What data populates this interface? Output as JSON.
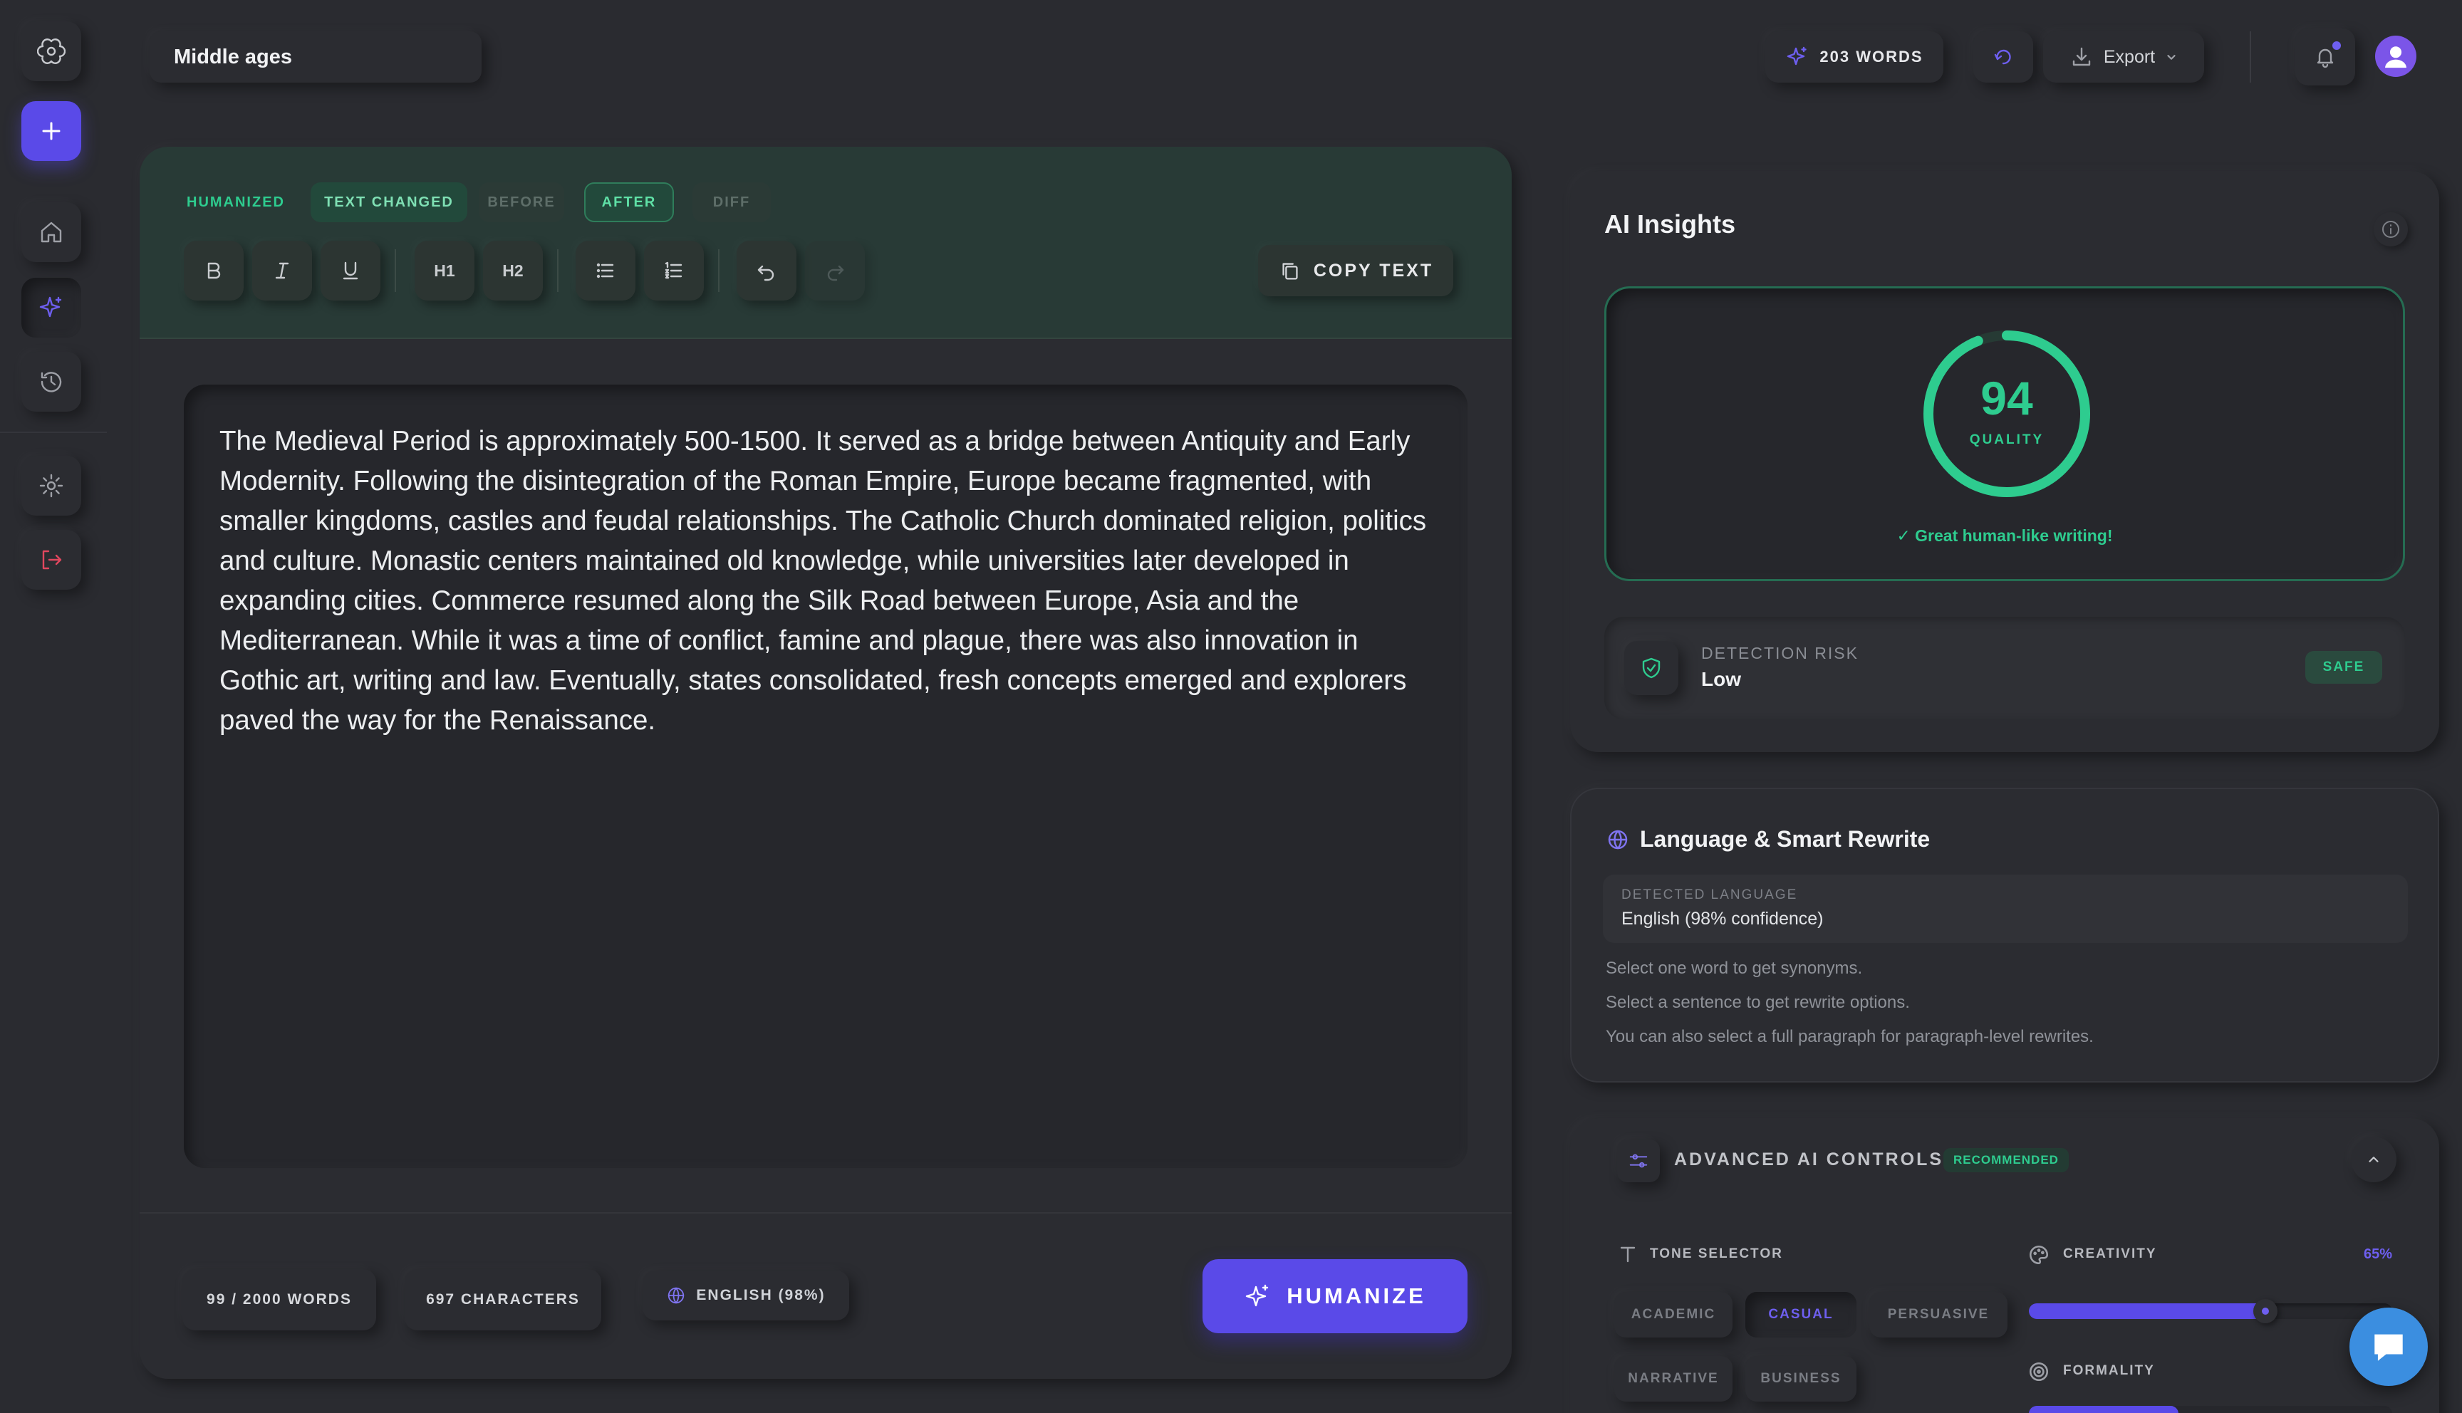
{
  "header": {
    "doc_title": "Middle ages",
    "word_count_badge": "203 WORDS",
    "export_label": "Export"
  },
  "editor": {
    "chips": {
      "humanized": "HUMANIZED",
      "text_changed": "TEXT CHANGED",
      "before": "BEFORE",
      "after": "AFTER",
      "diff": "DIFF"
    },
    "format": {
      "h1": "H1",
      "h2": "H2"
    },
    "copy_label": "COPY TEXT",
    "body_text": "The Medieval Period is approximately 500-1500. It served as a bridge between Antiquity and Early Modernity. Following the disintegration of the Roman Empire, Europe became fragmented, with smaller kingdoms, castles and feudal relationships. The Catholic Church dominated religion, politics and culture. Monastic centers maintained old knowledge, while universities later developed in expanding cities. Commerce resumed along the Silk Road between Europe, Asia and the Mediterranean. While it was a time of conflict, famine and plague, there was also innovation in Gothic art, writing and law. Eventually, states consolidated, fresh concepts emerged and explorers paved the way for the Renaissance.",
    "footer": {
      "words": "99 / 2000 WORDS",
      "characters": "697 CHARACTERS",
      "language": "ENGLISH (98%)",
      "humanize_label": "HUMANIZE"
    }
  },
  "insights": {
    "title": "AI Insights",
    "quality_score": "94",
    "quality_value": 94,
    "quality_label": "QUALITY",
    "quality_message": "✓ Great human-like writing!",
    "detection_label": "DETECTION RISK",
    "detection_value": "Low",
    "detection_badge": "SAFE"
  },
  "language": {
    "title": "Language & Smart Rewrite",
    "detected_label": "DETECTED LANGUAGE",
    "detected_value": "English (98% confidence)",
    "hints": [
      "Select one word to get synonyms.",
      "Select a sentence to get rewrite options.",
      "You can also select a full paragraph for paragraph-level rewrites."
    ]
  },
  "advanced": {
    "title": "ADVANCED AI CONTROLS",
    "badge": "RECOMMENDED",
    "tone_label": "TONE SELECTOR",
    "tones": [
      "ACADEMIC",
      "CASUAL",
      "PERSUASIVE",
      "NARRATIVE",
      "BUSINESS"
    ],
    "selected_tone": "CASUAL",
    "creativity_label": "CREATIVITY",
    "creativity_value": "65%",
    "creativity_fraction": 0.65,
    "formality_label": "FORMALITY"
  },
  "colors": {
    "accent": "#5a4ae8",
    "success": "#2ecc8f",
    "background": "#2a2b30"
  }
}
